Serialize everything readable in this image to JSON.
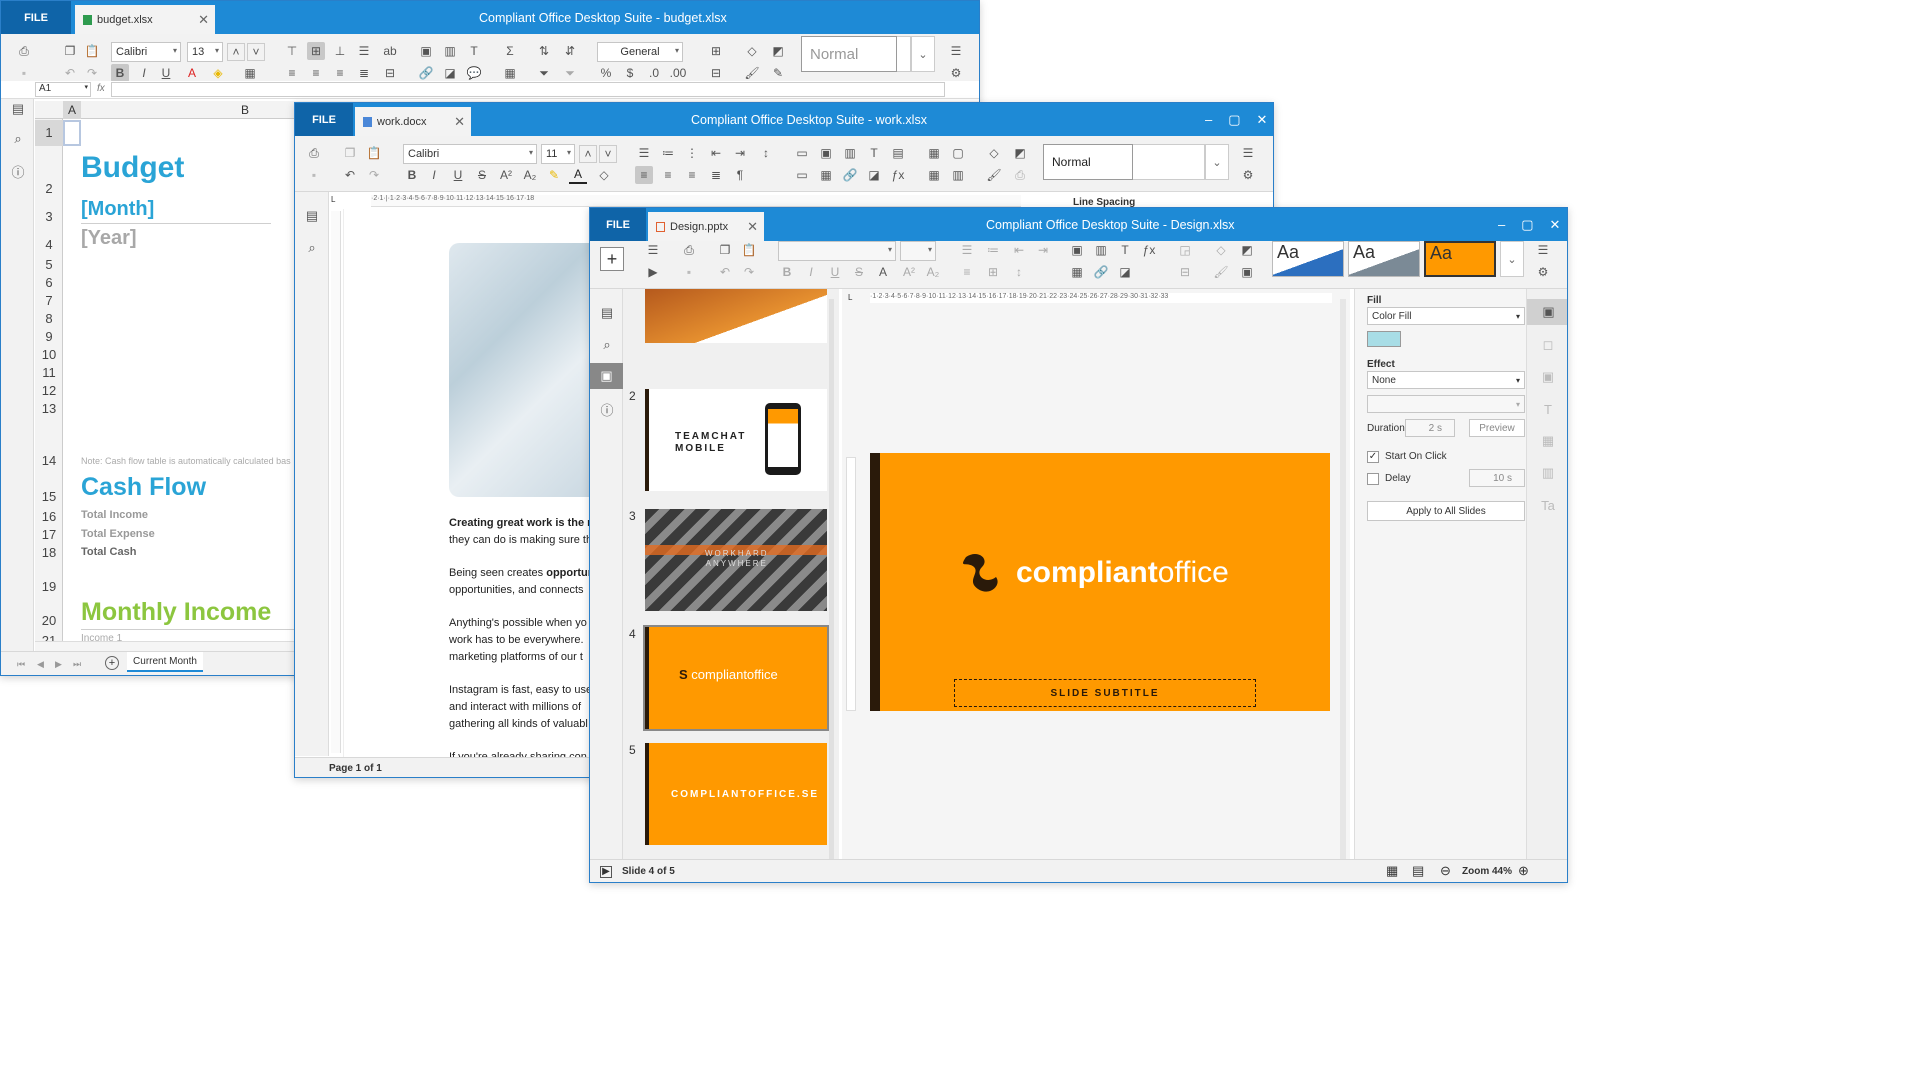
{
  "budget_window": {
    "file_label": "FILE",
    "tab_name": "budget.xlsx",
    "title": "Compliant Office Desktop Suite - budget.xlsx",
    "font_name": "Calibri",
    "font_size": "13",
    "number_format": "General",
    "style_name": "Normal",
    "cell_ref": "A1",
    "fx_label": "fx",
    "col_a": "A",
    "col_b": "B",
    "rows": [
      "1",
      "2",
      "3",
      "4",
      "5",
      "6",
      "7",
      "8",
      "9",
      "10",
      "11",
      "12",
      "13",
      "14",
      "15",
      "16",
      "17",
      "18",
      "19",
      "20",
      "21"
    ],
    "heading_budget": "Budget",
    "heading_month": "[Month]",
    "heading_year": "[Year]",
    "note": "Note: Cash flow table is automatically calculated bas",
    "heading_cashflow": "Cash Flow",
    "total_income": "Total Income",
    "total_expense": "Total Expense",
    "total_cash": "Total Cash",
    "heading_monthly_income": "Monthly Income",
    "income_1": "Income 1",
    "sheet_tab": "Current Month"
  },
  "work_window": {
    "file_label": "FILE",
    "tab_name": "work.docx",
    "title": "Compliant Office Desktop Suite - work.xlsx",
    "font_name": "Calibri",
    "font_size": "11",
    "style_name": "Normal",
    "side_label": "Line Spacing",
    "para1_bold": "Creating great work is the m",
    "para1_rest": "they can do is making sure th",
    "para2_a": "Being seen creates ",
    "para2_bold": "opportun",
    "para2_b": "opportunities, and connects",
    "para3_a": "Anything's possible when yo",
    "para3_b": "work has to be everywhere.",
    "para3_c": "marketing platforms of our t",
    "para4_a": "Instagram is fast, easy to use",
    "para4_b": "and interact with millions of",
    "para4_c": "gathering all kinds of valuabl",
    "para5_a": "If you're already sharing con",
    "page_status": "Page 1 of 1"
  },
  "design_window": {
    "file_label": "FILE",
    "tab_name": "Design.pptx",
    "title": "Compliant Office Desktop Suite - Design.xlsx",
    "theme_label": "Aa",
    "thumbs": [
      {
        "num": "2",
        "text": "TEAMCHAT\nMOBILE"
      },
      {
        "num": "3",
        "text": "WORKHARD\nANYWHERE"
      },
      {
        "num": "4",
        "text": "compliantoffice"
      },
      {
        "num": "5",
        "text": "COMPLIANTOFFICE.SE"
      }
    ],
    "thumb2_line1": "TEAMCHAT",
    "thumb2_line2": "MOBILE",
    "thumb3_line1": "WORKHARD",
    "thumb3_line2": "ANYWHERE",
    "thumb4_logo": "compliantoffice",
    "thumb5_text": "COMPLIANTOFFICE.SE",
    "slide_logo_a": "compliant",
    "slide_logo_b": "office",
    "slide_subtitle": "SLIDE SUBTITLE",
    "panel": {
      "fill_label": "Fill",
      "fill_value": "Color Fill",
      "effect_label": "Effect",
      "effect_value": "None",
      "duration_label": "Duration",
      "duration_value": "2 s",
      "preview_btn": "Preview",
      "start_on_click": "Start On Click",
      "delay_label": "Delay",
      "delay_value": "10 s",
      "apply_all": "Apply to All Slides"
    },
    "status_slide": "Slide 4 of 5",
    "zoom": "Zoom 44%",
    "colors": {
      "accent": "#ff9900",
      "titlebar": "#1e8ad6",
      "fill_swatch": "#a8dde6"
    }
  }
}
